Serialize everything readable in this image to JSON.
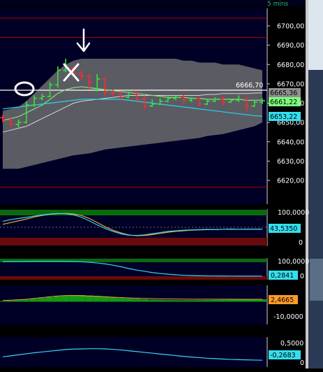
{
  "header": {
    "timeframe": "5 mins"
  },
  "colors": {
    "background": "#000000",
    "panel_bg": "#000026",
    "up_candle": "#36e23a",
    "down_candle": "#ff2a2a",
    "band_fill": "#7a7a7a",
    "price_line": "#ffffff",
    "ma_cyan": "#27d6e6",
    "ma_green": "#7de07d",
    "level_red": "#b00000",
    "osc_orange": "#f2a23a",
    "osc_cyan": "#33d6ee",
    "overbought_zone": "#0b6a0b",
    "oversold_zone": "#6a0b0b",
    "histogram": "#139a13",
    "tag_grey": "#9a9a9a",
    "tag_green": "#7cff7c",
    "tag_cyan": "#33e0f0",
    "tag_orange": "#ff9a2a"
  },
  "panels": {
    "price": {
      "axis_ticks": [
        "6700,00",
        "6690,00",
        "6680,00",
        "6670,00",
        "6660,00",
        "6650,00",
        "6640,00",
        "6630,00",
        "6620,00"
      ],
      "tags": {
        "level_white": "6666,70",
        "upper_band": "6665,36",
        "last_price": "6661,22",
        "ma": "6653,22"
      }
    },
    "stochastic": {
      "axis_ticks": [
        "100,0000",
        "0"
      ],
      "tag": "43,5350"
    },
    "momentum": {
      "axis_ticks": [
        "100,0000",
        "0"
      ],
      "tag": "0,2841"
    },
    "macd": {
      "axis_ticks": [
        "-10,0000"
      ],
      "tag": "2,4665"
    },
    "cci": {
      "axis_ticks": [
        "0,5000",
        "0"
      ],
      "tag": "-0,2683"
    }
  },
  "chart_data": [
    {
      "type": "candlestick",
      "title": "",
      "ylim": [
        6616,
        6706
      ],
      "yticks": [
        6700,
        6690,
        6680,
        6670,
        6660,
        6650,
        6640,
        6630,
        6620
      ],
      "bars": [
        {
          "o": 6652.5,
          "h": 6654,
          "c": 6651.5,
          "l": 6650
        },
        {
          "o": 6651,
          "h": 6652.5,
          "c": 6649,
          "l": 6648
        },
        {
          "o": 6649,
          "h": 6651.5,
          "c": 6650,
          "l": 6647.5
        },
        {
          "o": 6650,
          "h": 6661,
          "c": 6659,
          "l": 6649.5
        },
        {
          "o": 6659,
          "h": 6664,
          "c": 6662.5,
          "l": 6658
        },
        {
          "o": 6662.5,
          "h": 6665,
          "c": 6663.5,
          "l": 6661.5
        },
        {
          "o": 6663.5,
          "h": 6671,
          "c": 6669.5,
          "l": 6663
        },
        {
          "o": 6669.5,
          "h": 6679,
          "c": 6677,
          "l": 6668
        },
        {
          "o": 6677,
          "h": 6683,
          "c": 6678,
          "l": 6676
        },
        {
          "o": 6678,
          "h": 6679,
          "c": 6675.5,
          "l": 6674
        },
        {
          "o": 6675.5,
          "h": 6677,
          "c": 6674,
          "l": 6672
        },
        {
          "o": 6674,
          "h": 6675,
          "c": 6671,
          "l": 6667
        },
        {
          "o": 6667,
          "h": 6675,
          "c": 6672.5,
          "l": 6666
        },
        {
          "o": 6672.5,
          "h": 6673,
          "c": 6665.5,
          "l": 6664
        },
        {
          "o": 6665.5,
          "h": 6667,
          "c": 6665,
          "l": 6664
        },
        {
          "o": 6665,
          "h": 6666,
          "c": 6663,
          "l": 6662
        },
        {
          "o": 6663,
          "h": 6666,
          "c": 6665.5,
          "l": 6662.5
        },
        {
          "o": 6665.5,
          "h": 6666.5,
          "c": 6662,
          "l": 6661
        },
        {
          "o": 6662,
          "h": 6664,
          "c": 6658.5,
          "l": 6657
        },
        {
          "o": 6658.5,
          "h": 6662,
          "c": 6659.5,
          "l": 6658
        },
        {
          "o": 6659.5,
          "h": 6662.5,
          "c": 6661,
          "l": 6659
        },
        {
          "o": 6661,
          "h": 6663.5,
          "c": 6662.5,
          "l": 6660.5
        },
        {
          "o": 6662.5,
          "h": 6664,
          "c": 6663,
          "l": 6661.5
        },
        {
          "o": 6663,
          "h": 6664.5,
          "c": 6661.5,
          "l": 6660
        },
        {
          "o": 6661.5,
          "h": 6663,
          "c": 6662.5,
          "l": 6660.5
        },
        {
          "o": 6662.5,
          "h": 6663,
          "c": 6659.5,
          "l": 6658.5
        },
        {
          "o": 6659.5,
          "h": 6662,
          "c": 6661,
          "l": 6659
        },
        {
          "o": 6661,
          "h": 6663,
          "c": 6662,
          "l": 6660.5
        },
        {
          "o": 6662,
          "h": 6663.5,
          "c": 6660.5,
          "l": 6659
        },
        {
          "o": 6660.5,
          "h": 6662,
          "c": 6661.5,
          "l": 6660
        },
        {
          "o": 6661.5,
          "h": 6664,
          "c": 6662,
          "l": 6660.5
        },
        {
          "o": 6662,
          "h": 6663,
          "c": 6658.5,
          "l": 6656
        },
        {
          "o": 6658.5,
          "h": 6661.5,
          "c": 6660.5,
          "l": 6658
        },
        {
          "o": 6660.5,
          "h": 6662.5,
          "c": 6661.2,
          "l": 6659.5
        }
      ],
      "upper_band": [
        6656,
        6657,
        6658,
        6661,
        6665,
        6669,
        6673,
        6677,
        6680,
        6682,
        6683,
        6683,
        6683,
        6683,
        6683,
        6683,
        6683,
        6683,
        6683,
        6683,
        6683,
        6683,
        6683,
        6682,
        6682,
        6681,
        6681,
        6681,
        6680,
        6680,
        6680,
        6679,
        6678,
        6677
      ],
      "lower_band": [
        6626,
        6626,
        6626,
        6627,
        6628,
        6629,
        6630,
        6631,
        6632,
        6633,
        6633.5,
        6634,
        6635,
        6636,
        6636.5,
        6637,
        6637.5,
        6638,
        6638.5,
        6639,
        6639.5,
        6640,
        6640.5,
        6641,
        6641.5,
        6642,
        6643,
        6643.5,
        6644,
        6645,
        6646,
        6647,
        6648,
        6650
      ],
      "ma_cyan": [
        6657,
        6657.5,
        6658,
        6658.5,
        6659,
        6659.5,
        6660,
        6660.5,
        6661,
        6661.5,
        6662,
        6662,
        6662,
        6662,
        6662,
        6662,
        6661.5,
        6661,
        6660.5,
        6660,
        6659.5,
        6659,
        6658.5,
        6658,
        6657.5,
        6657,
        6656.5,
        6656,
        6655.5,
        6655,
        6654.5,
        6654,
        6653.5,
        6653.2
      ],
      "ma_green": [
        6651,
        6652,
        6653,
        6655,
        6657,
        6659,
        6662,
        6665,
        6667,
        6668,
        6668.5,
        6668,
        6667.5,
        6667,
        6666.5,
        6666,
        6665.5,
        6665,
        6664.5,
        6664,
        6663.5,
        6663,
        6663,
        6663,
        6662.5,
        6662.5,
        6662,
        6662,
        6662,
        6662,
        6662,
        6661.5,
        6661.5,
        6661.5
      ],
      "ma_grey": [
        6645,
        6646,
        6647,
        6648,
        6650,
        6652,
        6654,
        6656,
        6658,
        6660,
        6661,
        6661.5,
        6662,
        6662.5,
        6663,
        6663.5,
        6664,
        6664,
        6664,
        6664,
        6664,
        6664,
        6664,
        6664,
        6664,
        6664,
        6664.5,
        6664.5,
        6665,
        6665,
        6665,
        6665,
        6665.2,
        6665.36
      ],
      "reference_levels": [
        6666.7,
        6704,
        6694,
        6616.5
      ]
    },
    {
      "type": "line",
      "title": "",
      "ylim": [
        0,
        100
      ],
      "series": [
        {
          "values": [
            70,
            76,
            80,
            84,
            88,
            92,
            95,
            97,
            96,
            92,
            84,
            72,
            58,
            46,
            36,
            28,
            23,
            22,
            24,
            28,
            32,
            36,
            38,
            40,
            41,
            42,
            43,
            42,
            43,
            44,
            43,
            43.5,
            43.5,
            43.535
          ]
        },
        {
          "values": [
            60,
            66,
            72,
            78,
            85,
            90,
            94,
            96,
            97,
            95,
            90,
            80,
            66,
            52,
            40,
            31,
            24,
            21,
            22,
            25,
            29,
            33,
            36,
            38,
            40,
            41,
            42,
            42,
            43,
            43,
            43,
            43.5,
            43.5,
            43.5
          ]
        }
      ]
    },
    {
      "type": "line",
      "title": "",
      "ylim": [
        0,
        100
      ],
      "series": [
        {
          "values": [
            95,
            95,
            95.5,
            96,
            96.5,
            97,
            97,
            97,
            96.5,
            95.5,
            94,
            91,
            86,
            80,
            72,
            62,
            50,
            40,
            32,
            24,
            18,
            13,
            9,
            6,
            4,
            3,
            2,
            1.5,
            1,
            0.8,
            0.6,
            0.5,
            0.4,
            0.2841
          ]
        }
      ]
    },
    {
      "type": "bar",
      "title": "",
      "ylim": [
        -14,
        14
      ],
      "values": [
        0.5,
        1,
        1.5,
        2,
        3,
        4,
        5,
        6,
        7,
        7.5,
        7.5,
        7,
        6.5,
        5.5,
        5,
        4,
        3.5,
        3,
        2.5,
        2,
        1.8,
        1.6,
        1.5,
        1.4,
        1.4,
        1.5,
        1.6,
        1.8,
        2,
        2.1,
        2.2,
        2.3,
        2.4,
        2.4665
      ],
      "series": [
        {
          "values": [
            1,
            1.5,
            2,
            2.5,
            3.5,
            4.5,
            5.5,
            6.5,
            7,
            7,
            6.8,
            6.4,
            6,
            5.5,
            5,
            4.6,
            4.2,
            3.8,
            3.5,
            3.2,
            3,
            2.9,
            2.8,
            2.7,
            2.6,
            2.6,
            2.6,
            2.6,
            2.6,
            2.6,
            2.5,
            2.5,
            2.5,
            2.47
          ]
        }
      ]
    },
    {
      "type": "line",
      "title": "",
      "ylim": [
        -0.4,
        0.6
      ],
      "series": [
        {
          "values": [
            -0.1,
            -0.05,
            0,
            0.05,
            0.1,
            0.14,
            0.18,
            0.22,
            0.26,
            0.28,
            0.29,
            0.3,
            0.3,
            0.29,
            0.27,
            0.24,
            0.2,
            0.16,
            0.12,
            0.08,
            0.04,
            0,
            -0.04,
            -0.08,
            -0.11,
            -0.14,
            -0.17,
            -0.19,
            -0.21,
            -0.23,
            -0.24,
            -0.25,
            -0.26,
            -0.2683
          ]
        }
      ]
    }
  ]
}
